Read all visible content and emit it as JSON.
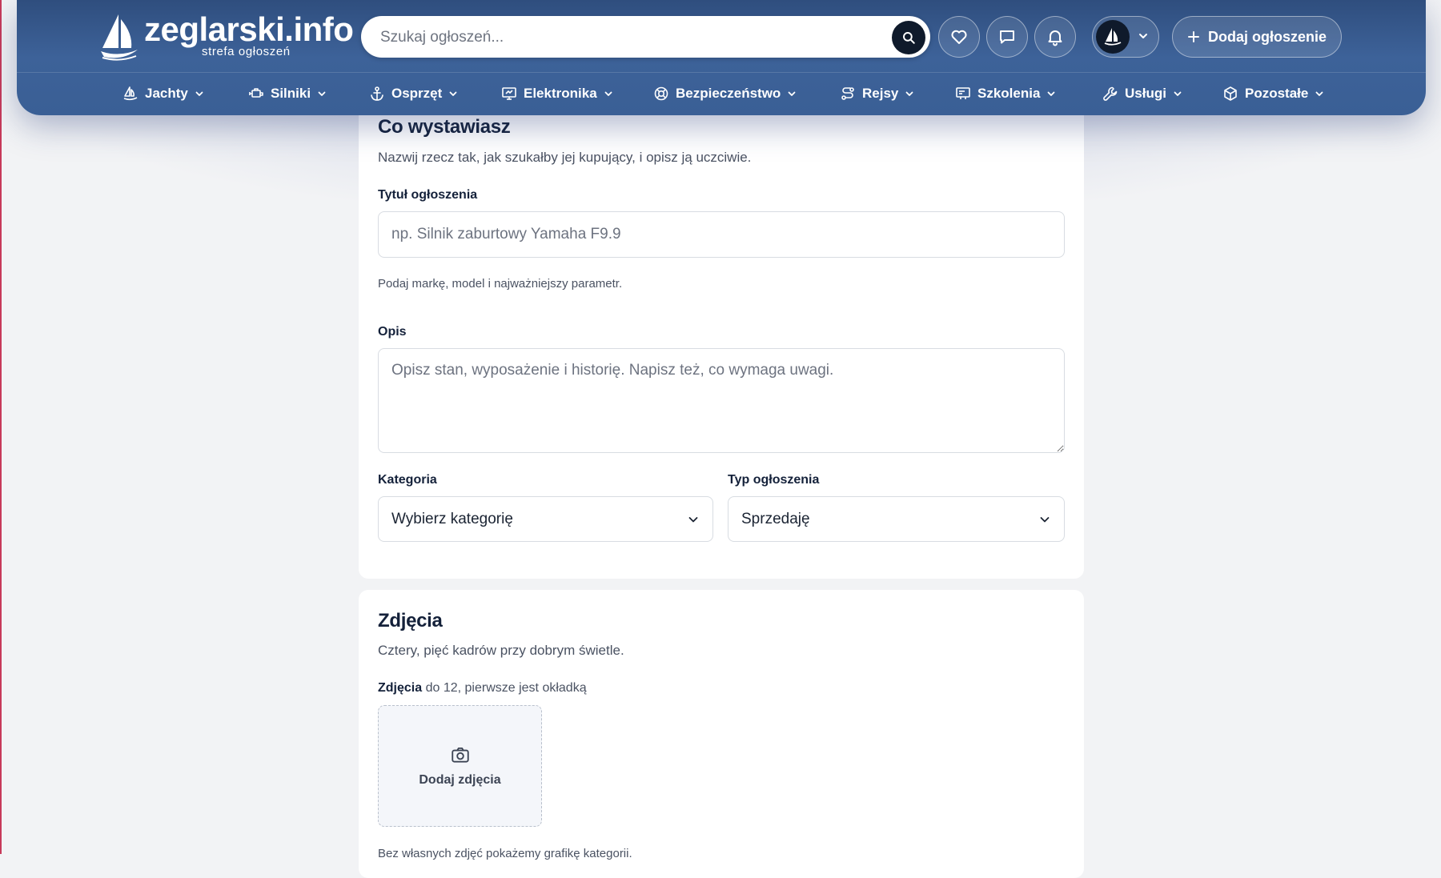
{
  "brand": {
    "name": "zeglarski.info",
    "tagline": "strefa ogłoszeń"
  },
  "search": {
    "placeholder": "Szukaj ogłoszeń...",
    "icon": "search-icon"
  },
  "header_actions": {
    "favorites_icon": "heart-icon",
    "messages_icon": "chat-icon",
    "notifications_icon": "bell-icon",
    "avatar_icon": "sailboat-icon",
    "add_listing_label": "Dodaj ogłoszenie"
  },
  "nav": {
    "items": [
      {
        "label": "Jachty",
        "icon": "sailboat-icon"
      },
      {
        "label": "Silniki",
        "icon": "engine-icon"
      },
      {
        "label": "Osprzęt",
        "icon": "anchor-icon"
      },
      {
        "label": "Elektronika",
        "icon": "monitor-icon"
      },
      {
        "label": "Bezpieczeństwo",
        "icon": "lifebuoy-icon"
      },
      {
        "label": "Rejsy",
        "icon": "route-icon"
      },
      {
        "label": "Szkolenia",
        "icon": "presentation-icon"
      },
      {
        "label": "Usługi",
        "icon": "wrench-icon"
      },
      {
        "label": "Pozostałe",
        "icon": "box-icon"
      }
    ]
  },
  "section_item": {
    "title": "Co wystawiasz",
    "lead": "Nazwij rzecz tak, jak szukałby jej kupujący, i opisz ją uczciwie.",
    "title_field": {
      "label": "Tytuł ogłoszenia",
      "placeholder": "np. Silnik zaburtowy Yamaha F9.9",
      "value": "",
      "hint": "Podaj markę, model i najważniejszy parametr."
    },
    "description_field": {
      "label": "Opis",
      "placeholder": "Opisz stan, wyposażenie i historię. Napisz też, co wymaga uwagi.",
      "value": ""
    },
    "category_field": {
      "label": "Kategoria",
      "selected": "Wybierz kategorię"
    },
    "type_field": {
      "label": "Typ ogłoszenia",
      "selected": "Sprzedaję"
    }
  },
  "section_photos": {
    "title": "Zdjęcia",
    "lead": "Cztery, pięć kadrów przy dobrym świetle.",
    "label_strong": "Zdjęcia",
    "label_rest": " do 12, pierwsze jest okładką",
    "add_label": "Dodaj zdjęcia",
    "add_icon": "camera-icon",
    "hint": "Bez własnych zdjęć pokażemy grafikę kategorii."
  },
  "colors": {
    "header_top": "#2f4e7e",
    "header_bottom": "#3a5f95",
    "accent_dark": "#0f1a2b",
    "page_bg": "#f2f3f5"
  }
}
